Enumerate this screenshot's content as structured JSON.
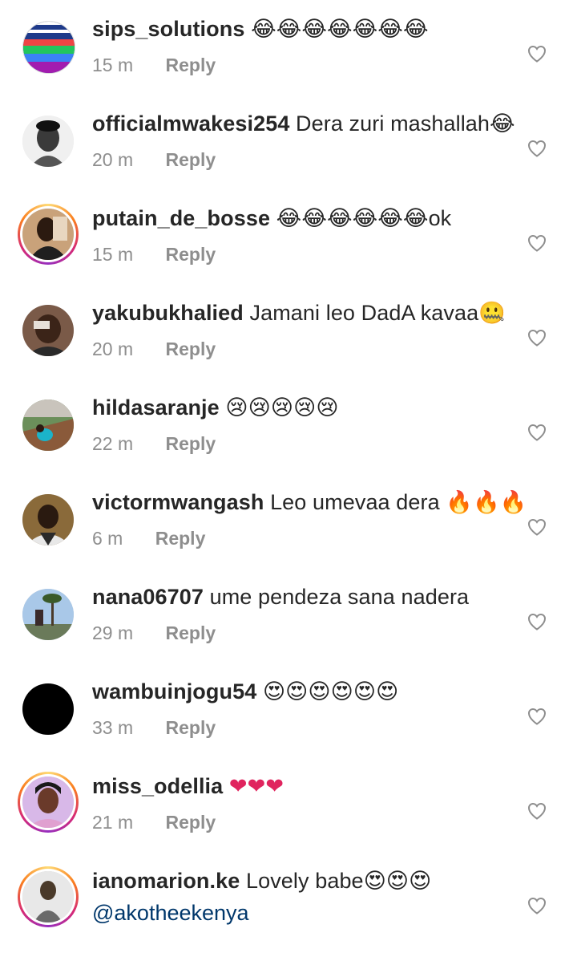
{
  "comments": [
    {
      "username": "sips_solutions",
      "text": "",
      "emoji": "😂😂😂😂😂😂😂",
      "time": "15 m",
      "reply": "Reply",
      "avatar": "sips-logo"
    },
    {
      "username": "officialmwakesi254",
      "text": " Dera zuri mashallah",
      "emoji": "😂",
      "time": "20 m",
      "reply": "Reply",
      "avatar": "photo"
    },
    {
      "username": "putain_de_bosse",
      "text": "",
      "emoji": "😂😂😂😂😂😂",
      "suffix": "ok",
      "time": "15 m",
      "reply": "Reply",
      "avatar": "photo-story"
    },
    {
      "username": "yakubukhalied",
      "text": " Jamani leo DadA kavaa",
      "emoji": "🤐",
      "time": "20 m",
      "reply": "Reply",
      "avatar": "photo"
    },
    {
      "username": "hildasaranje",
      "text": "",
      "emoji": "😢😢😢😢😢",
      "time": "22 m",
      "reply": "Reply",
      "avatar": "photo"
    },
    {
      "username": "victormwangash",
      "text": " Leo umevaa dera ",
      "emoji": "🔥🔥🔥",
      "time": "6 m",
      "reply": "Reply",
      "avatar": "photo"
    },
    {
      "username": "nana06707",
      "text": " ume pendeza sana nadera",
      "emoji": "",
      "time": "29 m",
      "reply": "Reply",
      "avatar": "photo"
    },
    {
      "username": "wambuinjogu54",
      "text": "",
      "emoji": "😍😍😍😍😍😍",
      "time": "33 m",
      "reply": "Reply",
      "avatar": "black"
    },
    {
      "username": "miss_odellia",
      "text": "",
      "emoji": "❤❤❤",
      "time": "21 m",
      "reply": "Reply",
      "avatar": "photo-story"
    },
    {
      "username": "ianomarion.ke",
      "text": " Lovely babe",
      "emoji": "😍😍😍",
      "mention": "@akotheekenya",
      "avatar": "photo-story"
    }
  ],
  "colors": {
    "username": "#262626",
    "meta": "#8e8e8e",
    "mention": "#00376b",
    "emoji_red": "#e0245e"
  },
  "icons": {
    "like": "heart-outline-icon"
  }
}
